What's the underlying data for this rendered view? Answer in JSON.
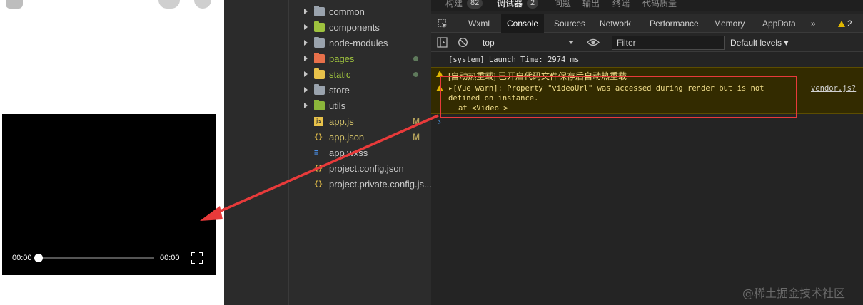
{
  "simulator": {
    "video": {
      "current_time": "00:00",
      "duration": "00:00",
      "progress": 0,
      "fullscreen_icon": "fullscreen-icon"
    }
  },
  "explorer": {
    "items": [
      {
        "label": "common",
        "type": "folder",
        "icon": "folder-icon",
        "icon_color": "#9aa3ad",
        "expandable": true
      },
      {
        "label": "components",
        "type": "folder",
        "icon": "components-folder-icon",
        "icon_color": "#9ec23e",
        "expandable": true
      },
      {
        "label": "node-modules",
        "type": "folder",
        "icon": "folder-icon",
        "icon_color": "#9aa3ad",
        "expandable": true
      },
      {
        "label": "pages",
        "type": "folder",
        "icon": "pages-folder-icon",
        "icon_color": "#e8704a",
        "expandable": true,
        "status": "modified-dot",
        "label_color": "#9ec23e"
      },
      {
        "label": "static",
        "type": "folder",
        "icon": "static-folder-icon",
        "icon_color": "#e8c24a",
        "expandable": true,
        "status": "modified-dot",
        "label_color": "#9ec23e"
      },
      {
        "label": "store",
        "type": "folder",
        "icon": "folder-icon",
        "icon_color": "#9aa3ad",
        "expandable": true
      },
      {
        "label": "utils",
        "type": "folder",
        "icon": "utils-folder-icon",
        "icon_color": "#8bb63a",
        "expandable": true
      },
      {
        "label": "app.js",
        "type": "file",
        "icon": "js-file-icon",
        "icon_color": "#e8c24a",
        "badge": "M",
        "label_color": "#d6c46a"
      },
      {
        "label": "app.json",
        "type": "file",
        "icon": "json-file-icon",
        "icon_color": "#e8c24a",
        "badge": "M",
        "label_color": "#d6c46a"
      },
      {
        "label": "app.wxss",
        "type": "file",
        "icon": "css-file-icon",
        "icon_color": "#4a8fe8"
      },
      {
        "label": "project.config.json",
        "type": "file",
        "icon": "json-file-icon",
        "icon_color": "#e8c24a"
      },
      {
        "label": "project.private.config.js...",
        "type": "file",
        "icon": "json-file-icon",
        "icon_color": "#e8c24a"
      }
    ]
  },
  "devtools": {
    "top_tabs": [
      {
        "label": "构建",
        "count": "82",
        "active": false
      },
      {
        "label": "调试器",
        "count": "2",
        "active": true
      },
      {
        "label": "问题",
        "count": "",
        "active": false
      },
      {
        "label": "输出",
        "count": "",
        "active": false
      },
      {
        "label": "终端",
        "count": "",
        "active": false
      },
      {
        "label": "代码质量",
        "count": "",
        "active": false
      }
    ],
    "panel_tabs": [
      {
        "label": "Wxml",
        "active": false
      },
      {
        "label": "Console",
        "active": true
      },
      {
        "label": "Sources",
        "active": false
      },
      {
        "label": "Network",
        "active": false
      },
      {
        "label": "Performance",
        "active": false
      },
      {
        "label": "Memory",
        "active": false
      },
      {
        "label": "AppData",
        "active": false
      }
    ],
    "more_tabs_label": "»",
    "warning_count": "2",
    "toolbar": {
      "context": "top",
      "filter_placeholder": "Filter",
      "levels": "Default levels ▾"
    },
    "console": {
      "system_message": "[system] Launch Time: 2974 ms",
      "hot_reload_message": "[自动热重载] 已开启代码文件保存后自动热重载",
      "vue_warn": {
        "line1": "▸[Vue warn]: Property \"videoUrl\" was accessed during render but is not",
        "line2": "defined on instance.",
        "line3": "at <Video >",
        "source": "vendor.js?"
      },
      "prompt": "›"
    },
    "colors": {
      "accent_warning": "#e0b700",
      "highlight_box": "#e83a3a",
      "arrow": "#e83a3a"
    }
  },
  "watermark": "@稀土掘金技术社区"
}
